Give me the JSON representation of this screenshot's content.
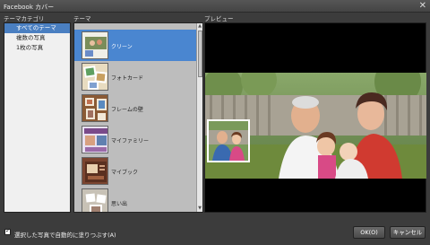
{
  "window": {
    "title": "Facebook カバー",
    "close_glyph": "✕"
  },
  "columns": {
    "category": "テーマカテゴリ",
    "theme": "テーマ",
    "preview": "プレビュー"
  },
  "categories": [
    {
      "label": "すべてのテーマ",
      "selected": true
    },
    {
      "label": "複数の写真",
      "selected": false
    },
    {
      "label": "1枚の写真",
      "selected": false
    }
  ],
  "themes": [
    {
      "label": "クリーン",
      "selected": true,
      "accent": "#f0efe8"
    },
    {
      "label": "フォトカード",
      "selected": false,
      "accent": "#d0b070"
    },
    {
      "label": "フレームの壁",
      "selected": false,
      "accent": "#8a5a35"
    },
    {
      "label": "マイファミリー",
      "selected": false,
      "accent": "#7a4a8a"
    },
    {
      "label": "マイブック",
      "selected": false,
      "accent": "#7b4530"
    },
    {
      "label": "思い出",
      "selected": false,
      "accent": "#c8c2b6"
    }
  ],
  "footer": {
    "auto_fill_label": "選択した写真で自動的に塗りつぶす(A)",
    "auto_fill_checked": true,
    "ok_label": "OK(O)",
    "cancel_label": "キャンセル"
  },
  "colors": {
    "selection": "#4a86d0",
    "category_selection": "#4a7fc1"
  }
}
